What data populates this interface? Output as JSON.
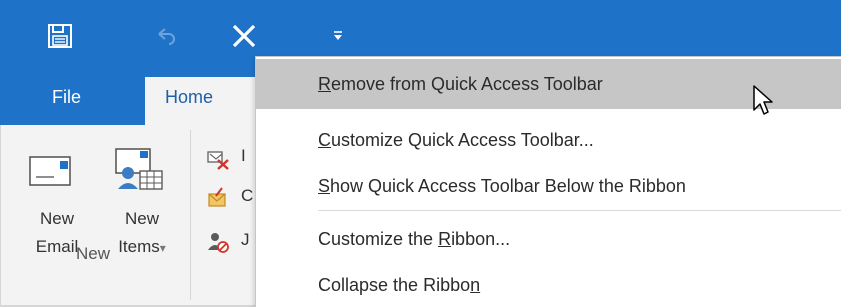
{
  "qat": {
    "save_icon": "save-icon",
    "undo_icon": "undo-icon",
    "remove_icon": "close-icon",
    "customize_icon": "customize-qat-icon"
  },
  "tabs": {
    "file": "File",
    "home": "Home"
  },
  "ribbon": {
    "new_email_line1": "New",
    "new_email_line2": "Email",
    "new_items_line1": "New",
    "new_items_line2": "Items",
    "new_items_caret": "▾",
    "group_label": "New",
    "small_items": [
      {
        "text": "I",
        "icon": "ignore-icon"
      },
      {
        "text": "C",
        "icon": "cleanup-icon"
      },
      {
        "text": "J",
        "icon": "junk-icon"
      }
    ]
  },
  "menu": {
    "items": [
      {
        "pre": "",
        "acc": "R",
        "post": "emove from Quick Access Toolbar"
      },
      {
        "pre": "",
        "acc": "C",
        "post": "ustomize Quick Access Toolbar..."
      },
      {
        "pre": "",
        "acc": "S",
        "post": "how Quick Access Toolbar Below the Ribbon"
      },
      {
        "pre": "Customize the ",
        "acc": "R",
        "post": "ibbon..."
      },
      {
        "pre": "Collapse the Ribbo",
        "acc": "n",
        "post": ""
      }
    ]
  },
  "colors": {
    "title_bar": "#1e73c8",
    "ribbon": "#f3f3f3",
    "menu_highlight": "#c6c6c6",
    "home_tab_text": "#1e5fa8"
  }
}
